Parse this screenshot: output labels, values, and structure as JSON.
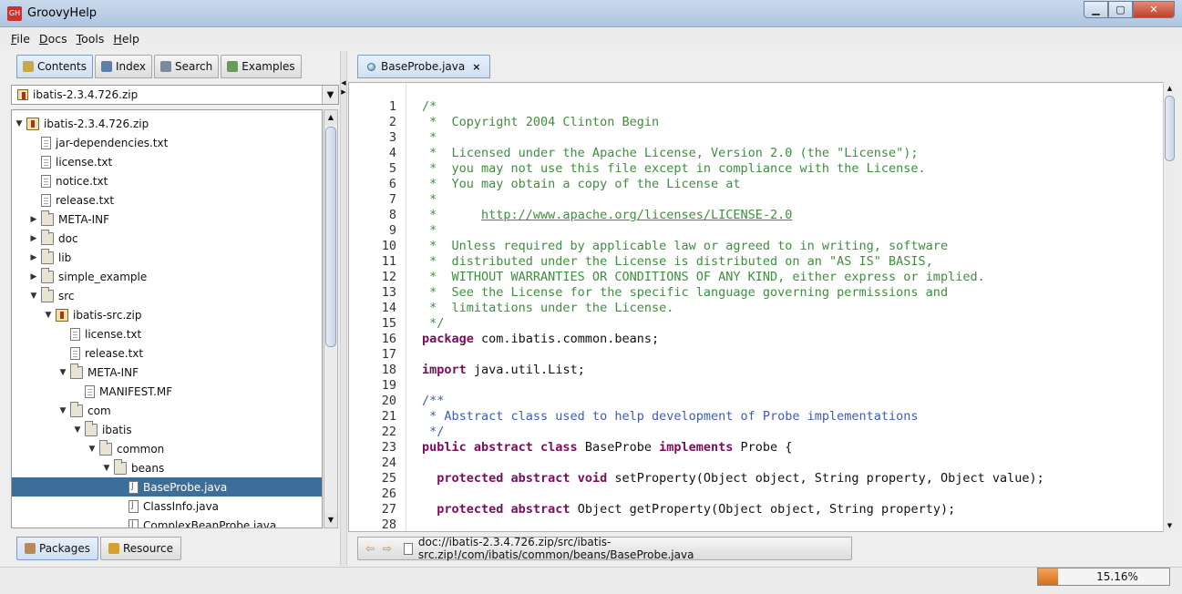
{
  "window": {
    "title": "GroovyHelp",
    "app_icon_text": "GH",
    "minimize_icon": "minimize-icon",
    "maximize_icon": "maximize-icon",
    "close_icon": "close-icon"
  },
  "menu": [
    {
      "label": "File",
      "mnemonic": "F",
      "rest": "ile"
    },
    {
      "label": "Docs",
      "mnemonic": "D",
      "rest": "ocs"
    },
    {
      "label": "Tools",
      "mnemonic": "T",
      "rest": "ools"
    },
    {
      "label": "Help",
      "mnemonic": "H",
      "rest": "elp"
    }
  ],
  "left_tabs": [
    {
      "label": "Contents",
      "icon": "book-icon",
      "active": true
    },
    {
      "label": "Index",
      "icon": "magnifier-icon",
      "active": false
    },
    {
      "label": "Search",
      "icon": "search-page-icon",
      "active": false
    },
    {
      "label": "Examples",
      "icon": "examples-icon",
      "active": false
    }
  ],
  "archive_selector": {
    "value": "ibatis-2.3.4.726.zip",
    "icon": "archive-icon"
  },
  "tree": [
    {
      "label": "ibatis-2.3.4.726.zip",
      "type": "zip",
      "depth": 0,
      "toggle": "open"
    },
    {
      "label": "jar-dependencies.txt",
      "type": "file",
      "depth": 1,
      "toggle": "none"
    },
    {
      "label": "license.txt",
      "type": "file",
      "depth": 1,
      "toggle": "none"
    },
    {
      "label": "notice.txt",
      "type": "file",
      "depth": 1,
      "toggle": "none"
    },
    {
      "label": "release.txt",
      "type": "file",
      "depth": 1,
      "toggle": "none"
    },
    {
      "label": "META-INF",
      "type": "folder",
      "depth": 1,
      "toggle": "closed"
    },
    {
      "label": "doc",
      "type": "folder",
      "depth": 1,
      "toggle": "closed"
    },
    {
      "label": "lib",
      "type": "folder",
      "depth": 1,
      "toggle": "closed"
    },
    {
      "label": "simple_example",
      "type": "folder",
      "depth": 1,
      "toggle": "closed"
    },
    {
      "label": "src",
      "type": "folder",
      "depth": 1,
      "toggle": "open"
    },
    {
      "label": "ibatis-src.zip",
      "type": "zip",
      "depth": 2,
      "toggle": "open"
    },
    {
      "label": "license.txt",
      "type": "file",
      "depth": 3,
      "toggle": "none"
    },
    {
      "label": "release.txt",
      "type": "file",
      "depth": 3,
      "toggle": "none"
    },
    {
      "label": "META-INF",
      "type": "folder",
      "depth": 3,
      "toggle": "open"
    },
    {
      "label": "MANIFEST.MF",
      "type": "file",
      "depth": 4,
      "toggle": "none"
    },
    {
      "label": "com",
      "type": "folder",
      "depth": 3,
      "toggle": "open"
    },
    {
      "label": "ibatis",
      "type": "folder",
      "depth": 4,
      "toggle": "open"
    },
    {
      "label": "common",
      "type": "folder",
      "depth": 5,
      "toggle": "open"
    },
    {
      "label": "beans",
      "type": "folder",
      "depth": 6,
      "toggle": "open"
    },
    {
      "label": "BaseProbe.java",
      "type": "java",
      "depth": 7,
      "toggle": "none",
      "selected": true
    },
    {
      "label": "ClassInfo.java",
      "type": "java",
      "depth": 7,
      "toggle": "none"
    },
    {
      "label": "ComplexBeanProbe.java",
      "type": "java",
      "depth": 7,
      "toggle": "none"
    }
  ],
  "bottom_tabs": [
    {
      "label": "Packages",
      "icon": "packages-icon",
      "active": true
    },
    {
      "label": "Resource",
      "icon": "resource-icon",
      "active": false
    }
  ],
  "editor": {
    "tab_label": "BaseProbe.java",
    "tab_close": "×",
    "lines": [
      {
        "n": "1",
        "parts": [
          [
            "c",
            "/*"
          ]
        ]
      },
      {
        "n": "2",
        "parts": [
          [
            "c",
            " *  Copyright 2004 Clinton Begin"
          ]
        ]
      },
      {
        "n": "3",
        "parts": [
          [
            "c",
            " *"
          ]
        ]
      },
      {
        "n": "4",
        "parts": [
          [
            "c",
            " *  Licensed under the Apache License, Version 2.0 (the \"License\");"
          ]
        ]
      },
      {
        "n": "5",
        "parts": [
          [
            "c",
            " *  you may not use this file except in compliance with the License."
          ]
        ]
      },
      {
        "n": "6",
        "parts": [
          [
            "c",
            " *  You may obtain a copy of the License at"
          ]
        ]
      },
      {
        "n": "7",
        "parts": [
          [
            "c",
            " *"
          ]
        ]
      },
      {
        "n": "8",
        "parts": [
          [
            "c",
            " *      "
          ],
          [
            "link",
            "http://www.apache.org/licenses/LICENSE-2.0"
          ]
        ]
      },
      {
        "n": "9",
        "parts": [
          [
            "c",
            " *"
          ]
        ]
      },
      {
        "n": "10",
        "parts": [
          [
            "c",
            " *  Unless required by applicable law or agreed to in writing, software"
          ]
        ]
      },
      {
        "n": "11",
        "parts": [
          [
            "c",
            " *  distributed under the License is distributed on an \"AS IS\" BASIS,"
          ]
        ]
      },
      {
        "n": "12",
        "parts": [
          [
            "c",
            " *  WITHOUT WARRANTIES OR CONDITIONS OF ANY KIND, either express or implied."
          ]
        ]
      },
      {
        "n": "13",
        "parts": [
          [
            "c",
            " *  See the License for the specific language governing permissions and"
          ]
        ]
      },
      {
        "n": "14",
        "parts": [
          [
            "c",
            " *  limitations under the License."
          ]
        ]
      },
      {
        "n": "15",
        "parts": [
          [
            "c",
            " */"
          ]
        ]
      },
      {
        "n": "16",
        "parts": [
          [
            "k",
            "package"
          ],
          [
            "p",
            " com.ibatis.common.beans;"
          ]
        ]
      },
      {
        "n": "17",
        "parts": []
      },
      {
        "n": "18",
        "parts": [
          [
            "k",
            "import"
          ],
          [
            "p",
            " java.util.List;"
          ]
        ]
      },
      {
        "n": "19",
        "parts": []
      },
      {
        "n": "20",
        "parts": [
          [
            "d",
            "/**"
          ]
        ]
      },
      {
        "n": "21",
        "parts": [
          [
            "d",
            " * Abstract class used to help development of Probe implementations"
          ]
        ]
      },
      {
        "n": "22",
        "parts": [
          [
            "d",
            " */"
          ]
        ]
      },
      {
        "n": "23",
        "parts": [
          [
            "k",
            "public abstract class"
          ],
          [
            "p",
            " BaseProbe "
          ],
          [
            "k",
            "implements"
          ],
          [
            "p",
            " Probe {"
          ]
        ]
      },
      {
        "n": "24",
        "parts": []
      },
      {
        "n": "25",
        "parts": [
          [
            "p",
            "  "
          ],
          [
            "k",
            "protected abstract void"
          ],
          [
            "p",
            " setProperty(Object object, String property, Object value);"
          ]
        ]
      },
      {
        "n": "26",
        "parts": []
      },
      {
        "n": "27",
        "parts": [
          [
            "p",
            "  "
          ],
          [
            "k",
            "protected abstract"
          ],
          [
            "p",
            " Object getProperty(Object object, String property);"
          ]
        ]
      },
      {
        "n": "28",
        "parts": []
      }
    ]
  },
  "path_bar": {
    "back_icon": "back-arrow-icon",
    "forward_icon": "forward-arrow-icon",
    "path": "doc://ibatis-2.3.4.726.zip/src/ibatis-src.zip!/com/ibatis/common/beans/BaseProbe.java"
  },
  "status": {
    "progress_text": "15.16%",
    "progress_value": 0.1516,
    "progress_color": "#d4701a"
  }
}
